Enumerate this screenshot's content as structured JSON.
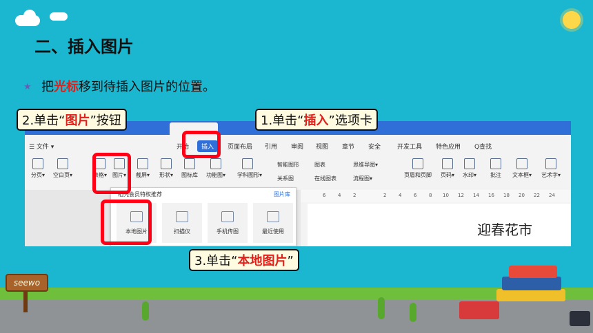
{
  "slide": {
    "title": "二、插入图片",
    "bullet_star": "★",
    "bullet_prefix": "把",
    "bullet_highlight": "光标",
    "bullet_suffix": "移到待插入图片的位置。",
    "sign_text": "seewo"
  },
  "callouts": {
    "c1_prefix": "1.单击“",
    "c1_highlight": "插入",
    "c1_suffix": "”选项卡",
    "c2_prefix": "2.单击“",
    "c2_highlight": "图片",
    "c2_suffix": "”按钮",
    "c3_prefix": "3.单击“",
    "c3_highlight": "本地图片",
    "c3_suffix": "”"
  },
  "app": {
    "menu_file": "☰ 文件 ▾",
    "menus": [
      "开始",
      "插入",
      "页面布局",
      "引用",
      "审阅",
      "视图",
      "章节",
      "安全",
      "开发工具",
      "特色应用",
      "Q查找"
    ],
    "ribbon": {
      "fenye": "分页▾",
      "kongbaiye": "空白页▾",
      "biaoge": "表格▾",
      "tupian": "图片▾",
      "jieping": "截屏▾",
      "xingzhuang": "形状▾",
      "tubiaoku": "图标库",
      "gongnengtu": "功能图▾",
      "xuekeshape": "学科图形▾",
      "zhineng": "智能图形",
      "tubiao": "图表",
      "guanxitu": "关系图",
      "zaixian": "在线图表",
      "siwei": "思维导图▾",
      "liucheng": "流程图▾",
      "yemei": "页眉和页脚",
      "yema": "页码▾",
      "shuiyin": "水印▾",
      "pizhu": "批注",
      "wenbenkuang": "文本框▾",
      "yishuzi": "艺术字▾"
    },
    "dropdown": {
      "header": "稻壳会员特权推荐",
      "right": "图片库",
      "items": [
        "本地图片",
        "扫描仪",
        "手机传图",
        "最近使用"
      ]
    },
    "ruler_ticks": [
      "6",
      "4",
      "2",
      "2",
      "4",
      "6",
      "8",
      "10",
      "12",
      "14",
      "16",
      "18",
      "20",
      "22",
      "24"
    ],
    "page_text": "迎春花市"
  },
  "colors": {
    "background": "#1bb7d0",
    "highlight": "#e0201b",
    "redbox": "#ff0016",
    "wps_blue": "#2f6fd7"
  }
}
